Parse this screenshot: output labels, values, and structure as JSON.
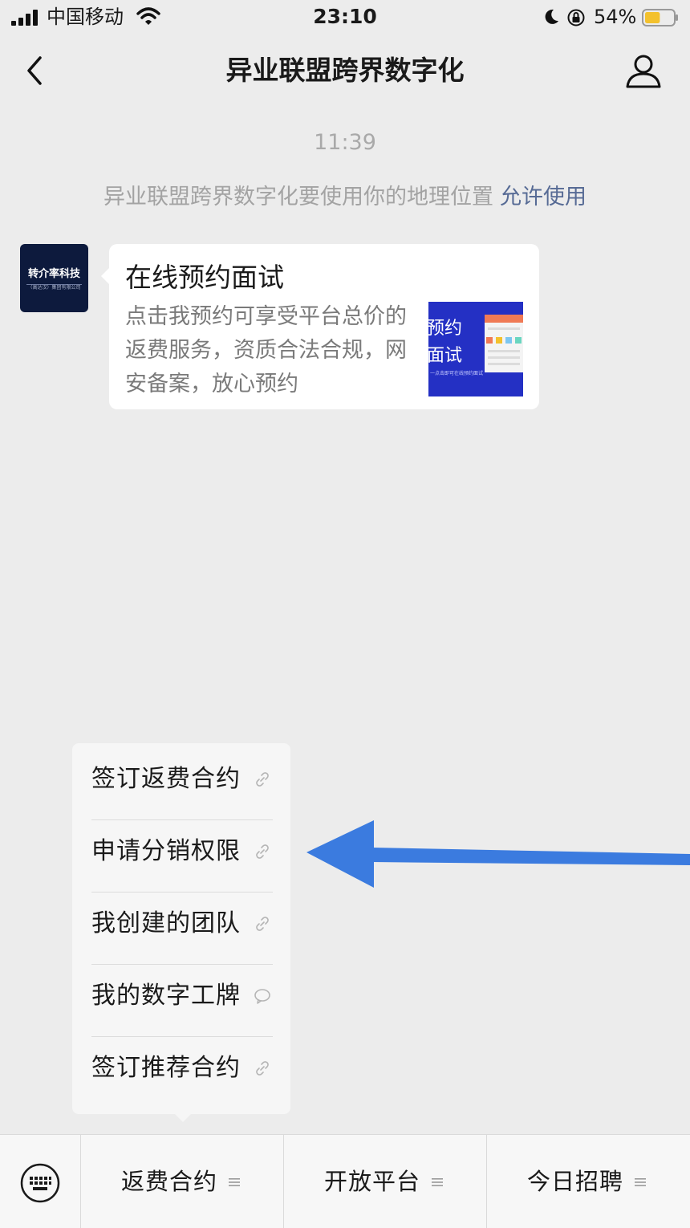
{
  "status_bar": {
    "carrier": "中国移动",
    "time": "23:10",
    "battery_percent": "54%",
    "battery_level": 0.54,
    "signal_bars": 4
  },
  "nav": {
    "title": "异业联盟跨界数字化",
    "back_icon": "chevron-left-icon",
    "profile_icon": "person-icon"
  },
  "chat": {
    "timestamp": "11:39",
    "system_message": "异业联盟跨界数字化要使用你的地理位置",
    "allow_link": "允许使用",
    "link_color": "#576b95",
    "sender_avatar": {
      "name": "转介率科技",
      "subtitle": "（高达汉）集团有限公司"
    },
    "card": {
      "title": "在线预约面试",
      "description": "点击我预约可享受平台总价的返费服务，资质合法合规，网安备案，放心预约",
      "thumbnail": {
        "line1": "预约",
        "line2": "面试",
        "caption": "一点击即可在线预约面试"
      }
    }
  },
  "popup_menu": {
    "items": [
      {
        "label": "签订返费合约",
        "icon": "link-icon"
      },
      {
        "label": "申请分销权限",
        "icon": "link-icon"
      },
      {
        "label": "我创建的团队",
        "icon": "link-icon"
      },
      {
        "label": "我的数字工牌",
        "icon": "chat-bubble-icon"
      },
      {
        "label": "签订推荐合约",
        "icon": "link-icon"
      }
    ]
  },
  "annotation": {
    "arrow_color": "#3b7bdf",
    "arrow_direction": "left"
  },
  "bottom_menu": {
    "keyboard_icon": "keyboard-icon",
    "tabs": [
      {
        "label": "返费合约",
        "icon": "menu-lines-icon"
      },
      {
        "label": "开放平台",
        "icon": "menu-lines-icon"
      },
      {
        "label": "今日招聘",
        "icon": "menu-lines-icon"
      }
    ]
  }
}
